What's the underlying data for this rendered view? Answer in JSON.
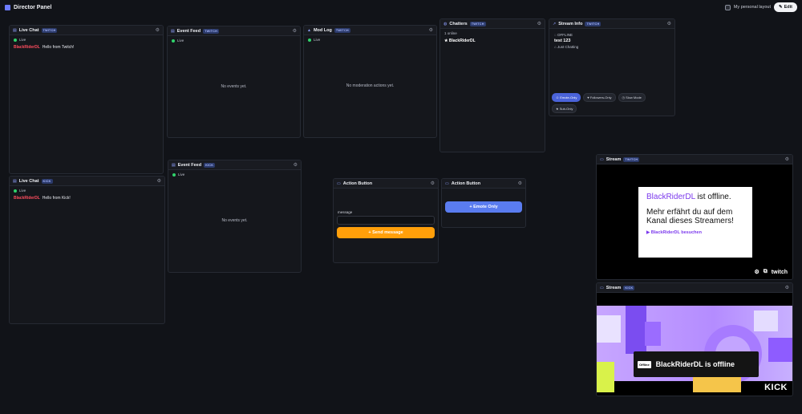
{
  "topbar": {
    "title": "Director Panel",
    "layout_label": "My personal layout",
    "edit_label": "Edit"
  },
  "panels": {
    "live_chat_twitch": {
      "title": "Live Chat",
      "badge": "TWITCH",
      "status": "Live",
      "messages": [
        {
          "user": "BlackRiderDL",
          "text": "Hello from Twitch!"
        }
      ]
    },
    "event_feed_twitch": {
      "title": "Event Feed",
      "badge": "TWITCH",
      "status": "Live",
      "empty": "No events yet."
    },
    "mod_log": {
      "title": "Mod Log",
      "badge": "TWITCH",
      "status": "Live",
      "empty": "No moderation actions yet."
    },
    "chatters": {
      "title": "Chatters",
      "badge": "TWITCH",
      "count": "1 online",
      "chatter": "BlackRiderDL"
    },
    "stream_info": {
      "title": "Stream Info",
      "badge": "TWITCH",
      "status": "OFFLINE",
      "stream_title": "test 123",
      "category": "Just Chatting",
      "modes": [
        {
          "label": "Emote-Only",
          "active": true
        },
        {
          "label": "Followers-Only",
          "active": false
        },
        {
          "label": "Slow Mode",
          "active": false
        },
        {
          "label": "Sub-Only",
          "active": false
        }
      ]
    },
    "live_chat_kick": {
      "title": "Live Chat",
      "badge": "KICK",
      "status": "Live",
      "messages": [
        {
          "user": "BlackRiderDL",
          "text": "Hello from Kick!"
        }
      ]
    },
    "event_feed_kick": {
      "title": "Event Feed",
      "badge": "KICK",
      "status": "Live",
      "empty": "No events yet."
    },
    "action_message": {
      "title": "Action Button",
      "field_label": "message",
      "button": "Send message"
    },
    "action_emote": {
      "title": "Action Button",
      "button": "Emote Only"
    },
    "stream_twitch": {
      "title": "Stream",
      "badge": "TWITCH",
      "channel": "BlackRiderDL",
      "offline_suffix": " ist offline.",
      "more": "Mehr erfährt du auf dem Kanal dieses Streamers!",
      "visit": "BlackRiderDL besuchen",
      "brand": "twitch"
    },
    "stream_kick": {
      "title": "Stream",
      "badge": "KICK",
      "offline_tag": "Offline",
      "offline_text": "BlackRiderDL is offline",
      "brand": "KICK"
    }
  },
  "colors": {
    "accent": "#5a7cf0",
    "orange": "#ff9f0a",
    "live": "#2fd36b",
    "username": "#ff4d5e",
    "twitch": "#7c3aed"
  }
}
